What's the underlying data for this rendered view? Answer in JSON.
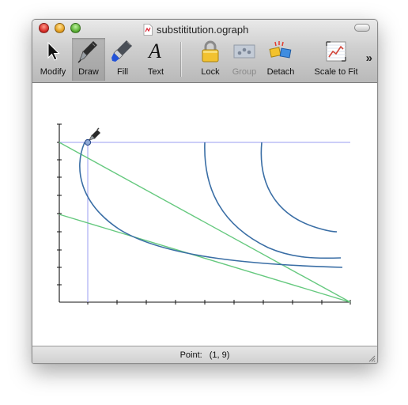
{
  "window": {
    "title": "substititution.ograph"
  },
  "toolbar": {
    "tools": [
      {
        "id": "modify",
        "label": "Modify",
        "icon": "arrow-pointer-icon",
        "state": "normal"
      },
      {
        "id": "draw",
        "label": "Draw",
        "icon": "fountain-pen-icon",
        "state": "selected"
      },
      {
        "id": "fill",
        "label": "Fill",
        "icon": "marker-icon",
        "state": "normal"
      },
      {
        "id": "text",
        "label": "Text",
        "icon": "text-a-icon",
        "state": "normal"
      },
      {
        "id": "lock",
        "label": "Lock",
        "icon": "padlock-icon",
        "state": "normal"
      },
      {
        "id": "group",
        "label": "Group",
        "icon": "group-icon",
        "state": "disabled"
      },
      {
        "id": "detach",
        "label": "Detach",
        "icon": "detach-icon",
        "state": "normal"
      },
      {
        "id": "scale",
        "label": "Scale to Fit",
        "icon": "scale-to-fit-icon",
        "state": "normal"
      }
    ],
    "overflow_label": "»"
  },
  "status": {
    "label": "Point:",
    "value": "(1, 9)"
  },
  "colors": {
    "curve": "#3a6ea5",
    "line": "#66c97f",
    "guide": "#9a9cf0"
  }
}
